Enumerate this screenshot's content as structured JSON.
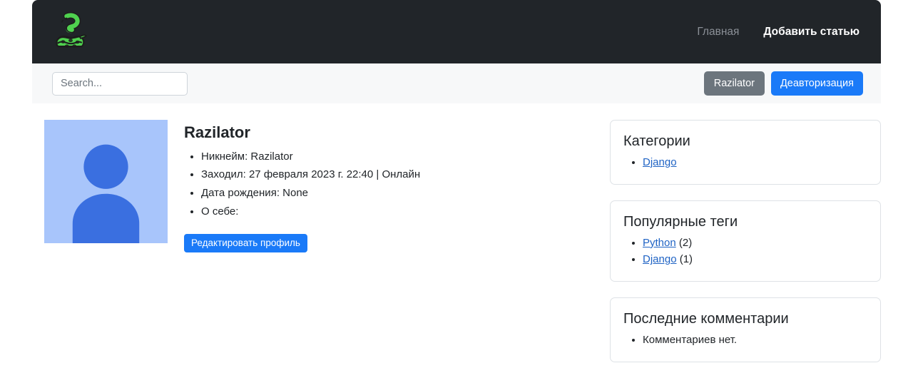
{
  "navbar": {
    "brand_icon": "snake-logo-icon",
    "brand_alt": "Python snake logo",
    "links": [
      {
        "label": "Главная",
        "active": false
      },
      {
        "label": "Добавить статью",
        "active": true
      }
    ]
  },
  "subbar": {
    "search": {
      "placeholder": "Search...",
      "value": ""
    },
    "user_button": "Razilator",
    "logout_button": "Деавторизация"
  },
  "profile": {
    "avatar_alt": "Аватар пользователя по умолчанию",
    "title": "Razilator",
    "details": [
      "Никнейм: Razilator",
      "Заходил: 27 февраля 2023 г. 22:40 | Онлайн",
      "Дата рождения: None",
      "О себе:"
    ],
    "edit_button": "Редактировать профиль"
  },
  "sidebar": {
    "categories": {
      "title": "Категории",
      "items": [
        {
          "label": "Django",
          "link": true
        }
      ]
    },
    "tags": {
      "title": "Популярные теги",
      "items": [
        {
          "label": "Python",
          "count": "(2)",
          "link": true
        },
        {
          "label": "Django",
          "count": "(1)",
          "link": true
        }
      ]
    },
    "comments": {
      "title": "Последние комментарии",
      "items": [
        {
          "label": "Комментариев нет.",
          "link": false
        }
      ]
    }
  },
  "colors": {
    "navbar_bg": "#212529",
    "subbar_bg": "#f7f8f9",
    "primary": "#1a7af8",
    "secondary": "#6c757d",
    "link": "#1f63c4",
    "logo_green": "#4fd14f",
    "avatar_bg": "#a8c5fb",
    "avatar_fg": "#3a6fe0"
  }
}
